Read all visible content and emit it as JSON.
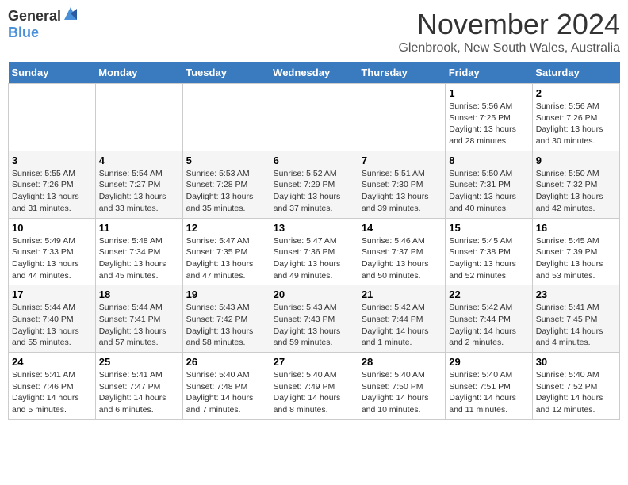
{
  "header": {
    "logo_general": "General",
    "logo_blue": "Blue",
    "month_title": "November 2024",
    "subtitle": "Glenbrook, New South Wales, Australia"
  },
  "days_of_week": [
    "Sunday",
    "Monday",
    "Tuesday",
    "Wednesday",
    "Thursday",
    "Friday",
    "Saturday"
  ],
  "weeks": [
    [
      {
        "day": "",
        "info": ""
      },
      {
        "day": "",
        "info": ""
      },
      {
        "day": "",
        "info": ""
      },
      {
        "day": "",
        "info": ""
      },
      {
        "day": "",
        "info": ""
      },
      {
        "day": "1",
        "info": "Sunrise: 5:56 AM\nSunset: 7:25 PM\nDaylight: 13 hours and 28 minutes."
      },
      {
        "day": "2",
        "info": "Sunrise: 5:56 AM\nSunset: 7:26 PM\nDaylight: 13 hours and 30 minutes."
      }
    ],
    [
      {
        "day": "3",
        "info": "Sunrise: 5:55 AM\nSunset: 7:26 PM\nDaylight: 13 hours and 31 minutes."
      },
      {
        "day": "4",
        "info": "Sunrise: 5:54 AM\nSunset: 7:27 PM\nDaylight: 13 hours and 33 minutes."
      },
      {
        "day": "5",
        "info": "Sunrise: 5:53 AM\nSunset: 7:28 PM\nDaylight: 13 hours and 35 minutes."
      },
      {
        "day": "6",
        "info": "Sunrise: 5:52 AM\nSunset: 7:29 PM\nDaylight: 13 hours and 37 minutes."
      },
      {
        "day": "7",
        "info": "Sunrise: 5:51 AM\nSunset: 7:30 PM\nDaylight: 13 hours and 39 minutes."
      },
      {
        "day": "8",
        "info": "Sunrise: 5:50 AM\nSunset: 7:31 PM\nDaylight: 13 hours and 40 minutes."
      },
      {
        "day": "9",
        "info": "Sunrise: 5:50 AM\nSunset: 7:32 PM\nDaylight: 13 hours and 42 minutes."
      }
    ],
    [
      {
        "day": "10",
        "info": "Sunrise: 5:49 AM\nSunset: 7:33 PM\nDaylight: 13 hours and 44 minutes."
      },
      {
        "day": "11",
        "info": "Sunrise: 5:48 AM\nSunset: 7:34 PM\nDaylight: 13 hours and 45 minutes."
      },
      {
        "day": "12",
        "info": "Sunrise: 5:47 AM\nSunset: 7:35 PM\nDaylight: 13 hours and 47 minutes."
      },
      {
        "day": "13",
        "info": "Sunrise: 5:47 AM\nSunset: 7:36 PM\nDaylight: 13 hours and 49 minutes."
      },
      {
        "day": "14",
        "info": "Sunrise: 5:46 AM\nSunset: 7:37 PM\nDaylight: 13 hours and 50 minutes."
      },
      {
        "day": "15",
        "info": "Sunrise: 5:45 AM\nSunset: 7:38 PM\nDaylight: 13 hours and 52 minutes."
      },
      {
        "day": "16",
        "info": "Sunrise: 5:45 AM\nSunset: 7:39 PM\nDaylight: 13 hours and 53 minutes."
      }
    ],
    [
      {
        "day": "17",
        "info": "Sunrise: 5:44 AM\nSunset: 7:40 PM\nDaylight: 13 hours and 55 minutes."
      },
      {
        "day": "18",
        "info": "Sunrise: 5:44 AM\nSunset: 7:41 PM\nDaylight: 13 hours and 57 minutes."
      },
      {
        "day": "19",
        "info": "Sunrise: 5:43 AM\nSunset: 7:42 PM\nDaylight: 13 hours and 58 minutes."
      },
      {
        "day": "20",
        "info": "Sunrise: 5:43 AM\nSunset: 7:43 PM\nDaylight: 13 hours and 59 minutes."
      },
      {
        "day": "21",
        "info": "Sunrise: 5:42 AM\nSunset: 7:44 PM\nDaylight: 14 hours and 1 minute."
      },
      {
        "day": "22",
        "info": "Sunrise: 5:42 AM\nSunset: 7:44 PM\nDaylight: 14 hours and 2 minutes."
      },
      {
        "day": "23",
        "info": "Sunrise: 5:41 AM\nSunset: 7:45 PM\nDaylight: 14 hours and 4 minutes."
      }
    ],
    [
      {
        "day": "24",
        "info": "Sunrise: 5:41 AM\nSunset: 7:46 PM\nDaylight: 14 hours and 5 minutes."
      },
      {
        "day": "25",
        "info": "Sunrise: 5:41 AM\nSunset: 7:47 PM\nDaylight: 14 hours and 6 minutes."
      },
      {
        "day": "26",
        "info": "Sunrise: 5:40 AM\nSunset: 7:48 PM\nDaylight: 14 hours and 7 minutes."
      },
      {
        "day": "27",
        "info": "Sunrise: 5:40 AM\nSunset: 7:49 PM\nDaylight: 14 hours and 8 minutes."
      },
      {
        "day": "28",
        "info": "Sunrise: 5:40 AM\nSunset: 7:50 PM\nDaylight: 14 hours and 10 minutes."
      },
      {
        "day": "29",
        "info": "Sunrise: 5:40 AM\nSunset: 7:51 PM\nDaylight: 14 hours and 11 minutes."
      },
      {
        "day": "30",
        "info": "Sunrise: 5:40 AM\nSunset: 7:52 PM\nDaylight: 14 hours and 12 minutes."
      }
    ]
  ]
}
